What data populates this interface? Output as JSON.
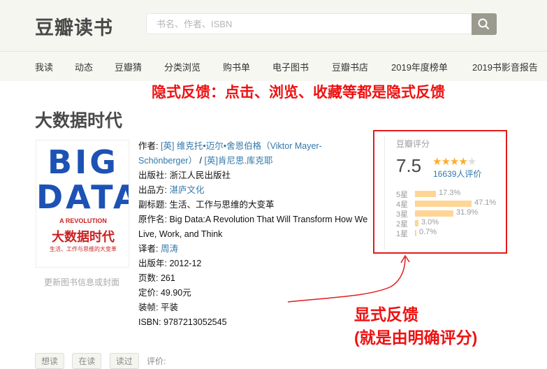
{
  "header": {
    "logo": "豆瓣读书",
    "search_placeholder": "书名、作者、ISBN"
  },
  "nav": {
    "items": [
      "我读",
      "动态",
      "豆瓣猜",
      "分类浏览",
      "购书单",
      "电子图书",
      "豆瓣书店",
      "2019年度榜单",
      "2019书影音报告"
    ]
  },
  "annotations": {
    "implicit": "隐式反馈：点击、浏览、收藏等都是隐式反馈",
    "explicit_line1": "显式反馈",
    "explicit_line2": "(就是由明确评分)"
  },
  "book": {
    "title": "大数据时代",
    "cover_link": "更新图书信息或封面",
    "cover": {
      "big": "BIG DATA",
      "sub1": "A REVOLUTION",
      "zh": "大数据时代",
      "sub2": "生活、工作与思维的大变革"
    },
    "author_label": "作者:",
    "author_value": "[英] 维克托•迈尔•舍恩伯格（Viktor Mayer-Schönberger）",
    "author_sep": " / ",
    "coauthor": "[英]肯尼思.库克耶",
    "publisher_label": "出版社:",
    "publisher": "浙江人民出版社",
    "producer_label": "出品方:",
    "producer": "湛庐文化",
    "subtitle_label": "副标题:",
    "subtitle": "生活、工作与思维的大变革",
    "original_label": "原作名:",
    "original": "Big Data:A Revolution That Will Transform How We Live, Work, and Think",
    "translator_label": "译者:",
    "translator": "周涛",
    "year_label": "出版年:",
    "year": "2012-12",
    "pages_label": "页数:",
    "pages": "261",
    "price_label": "定价:",
    "price": "49.90元",
    "binding_label": "装帧:",
    "binding": "平装",
    "isbn_label": "ISBN:",
    "isbn": "9787213052545"
  },
  "rating": {
    "label": "豆瓣评分",
    "score": "7.5",
    "stars": 3.75,
    "count": "16639人评价",
    "breakdown": [
      {
        "label": "5星",
        "pct": "17.3%",
        "value": 17.3
      },
      {
        "label": "4星",
        "pct": "47.1%",
        "value": 47.1
      },
      {
        "label": "3星",
        "pct": "31.9%",
        "value": 31.9
      },
      {
        "label": "2星",
        "pct": "3.0%",
        "value": 3.0
      },
      {
        "label": "1星",
        "pct": "0.7%",
        "value": 0.7
      }
    ]
  },
  "actions": {
    "want": "想读",
    "reading": "在读",
    "read": "读过",
    "rate_label": "评价:"
  },
  "colors": {
    "annotation": "#ee1111",
    "link": "#3377aa",
    "star": "#ffac2d",
    "bar": "#ffd596"
  }
}
